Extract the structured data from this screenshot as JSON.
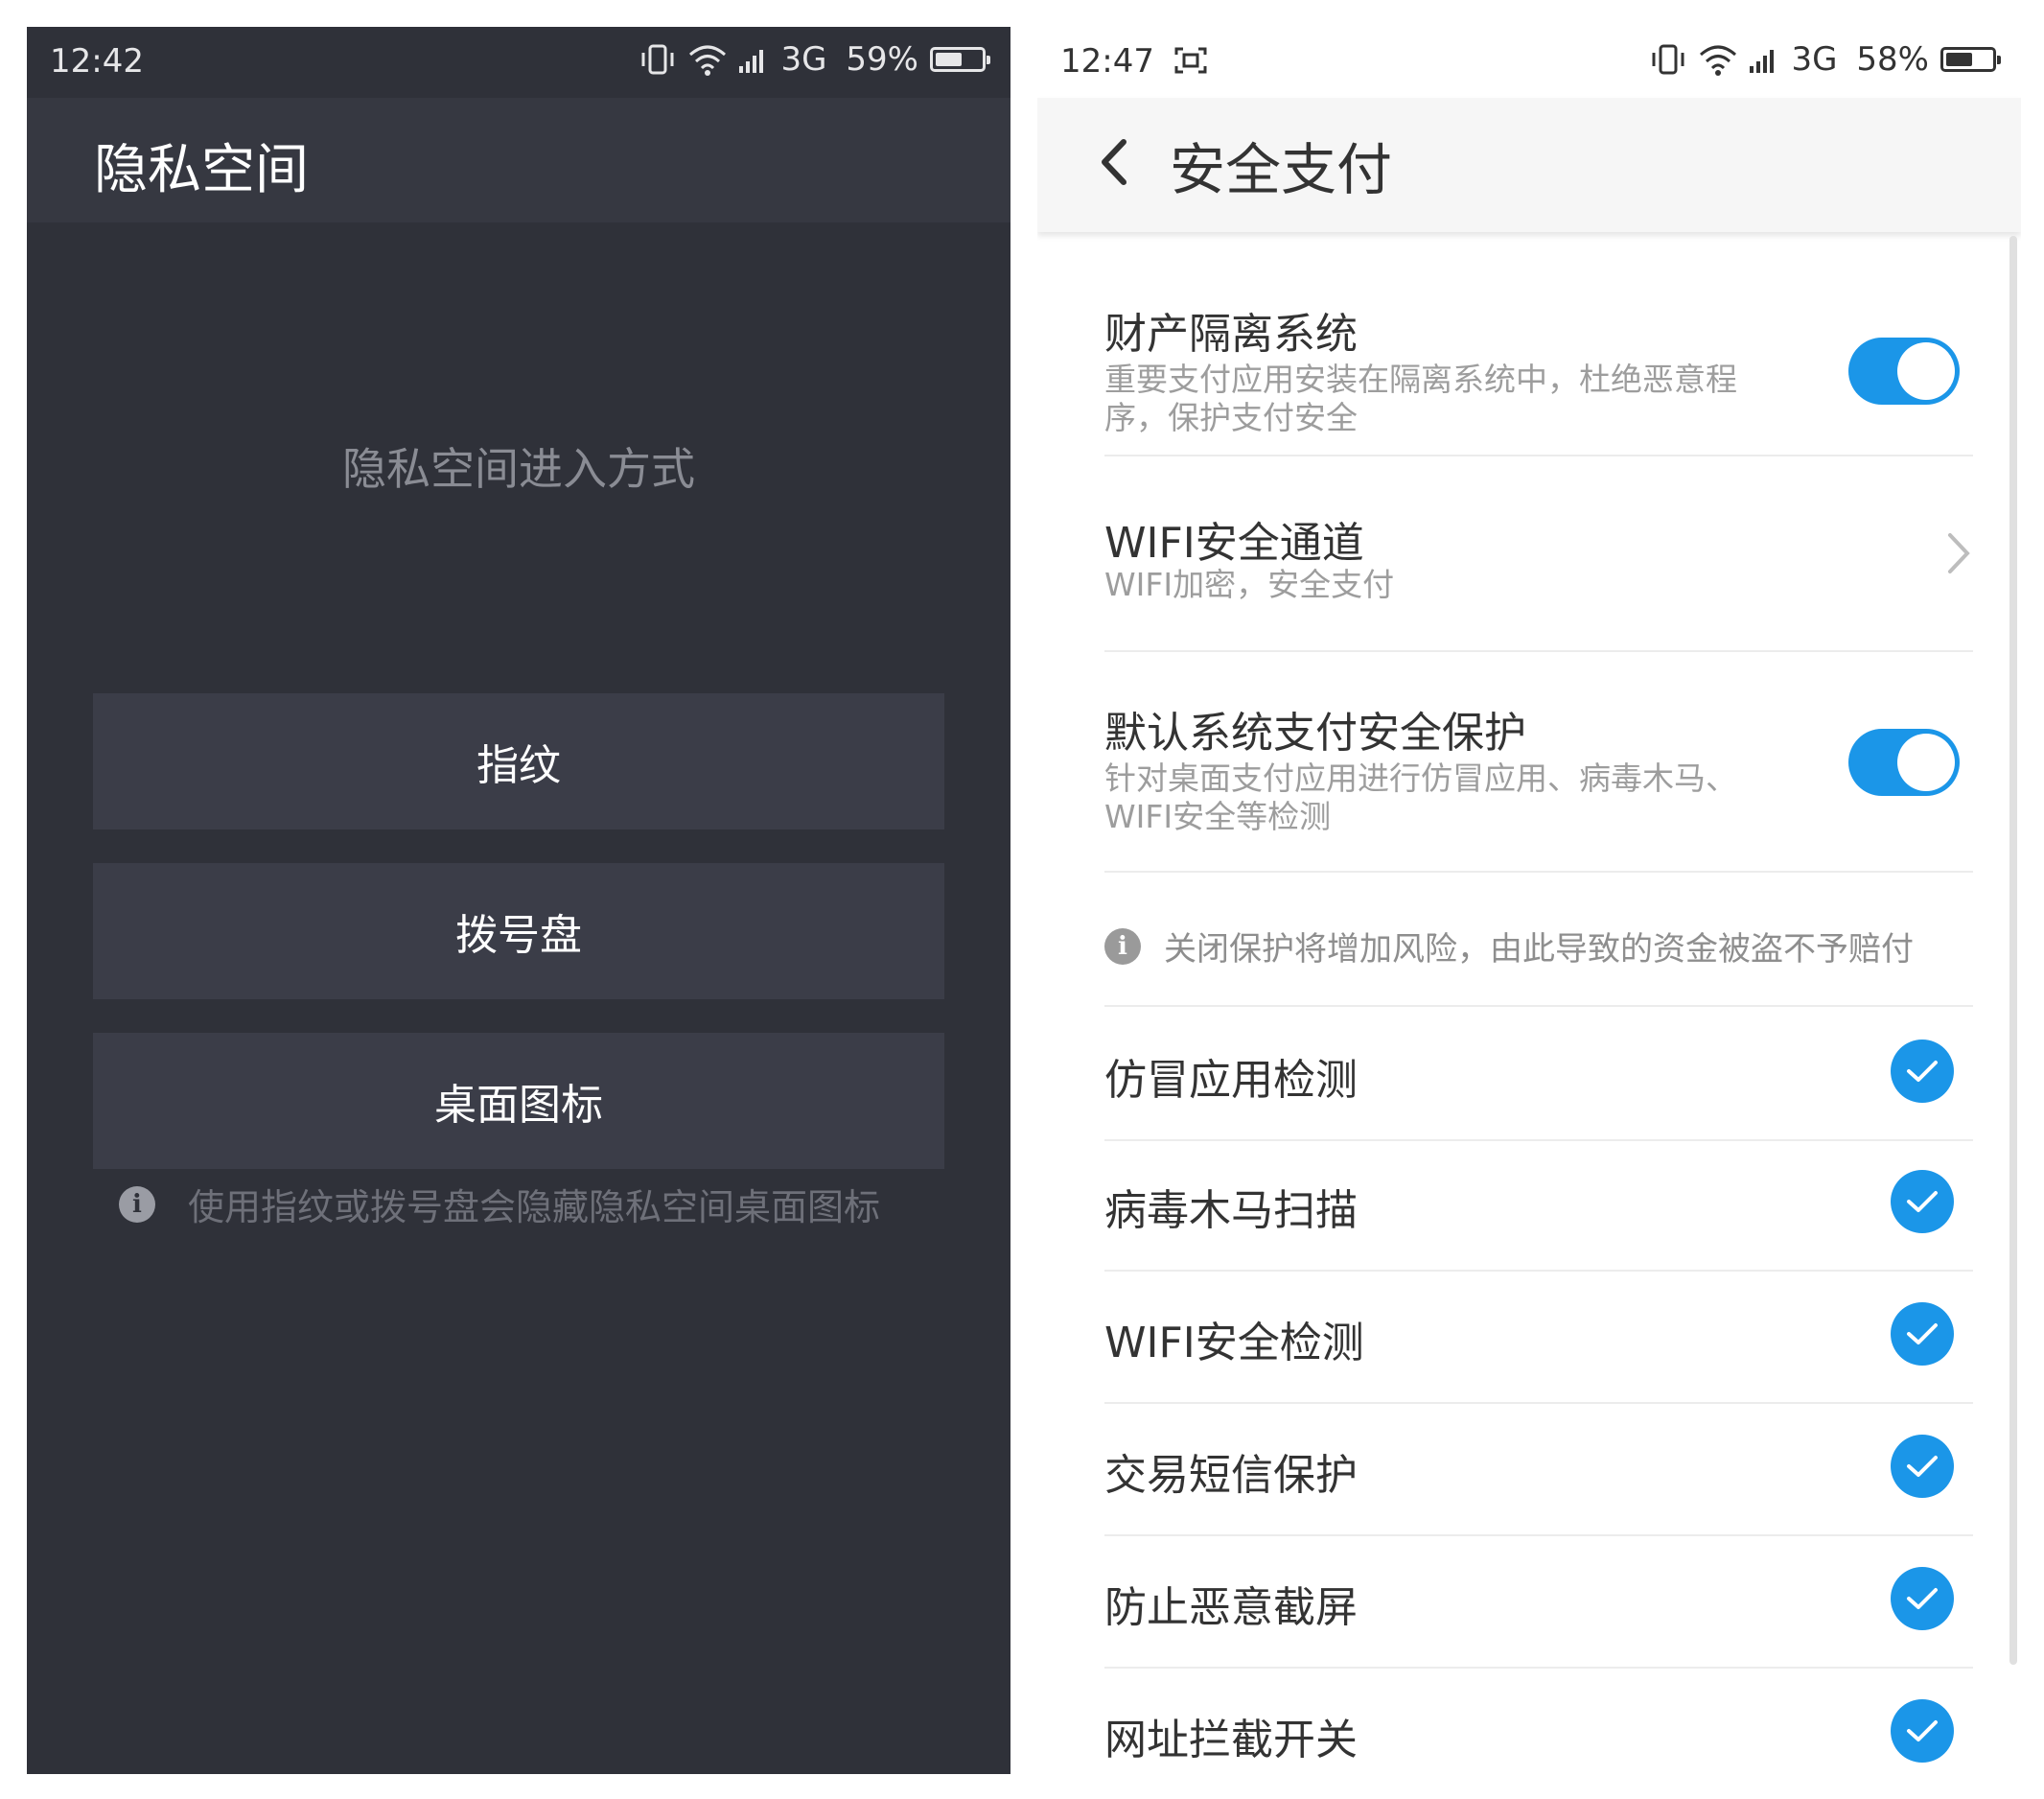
{
  "left": {
    "status": {
      "time": "12:42",
      "network": "3G",
      "battery": "59%",
      "battery_level": 0.59
    },
    "title": "隐私空间",
    "subtitle": "隐私空间进入方式",
    "options": [
      "指纹",
      "拨号盘",
      "桌面图标"
    ],
    "note": "使用指纹或拨号盘会隐藏隐私空间桌面图标"
  },
  "right": {
    "status": {
      "time": "12:47",
      "network": "3G",
      "battery": "58%",
      "battery_level": 0.58
    },
    "title": "安全支付",
    "items": [
      {
        "title": "财产隔离系统",
        "desc": "重要支付应用安装在隔离系统中，杜绝恶意程序，保护支付安全",
        "control": "toggle",
        "on": true
      },
      {
        "title": "WIFI安全通道",
        "desc": "WIFI加密，安全支付",
        "control": "chevron"
      },
      {
        "title": "默认系统支付安全保护",
        "desc": "针对桌面支付应用进行仿冒应用、病毒木马、WIFI安全等检测",
        "control": "toggle",
        "on": true
      }
    ],
    "warning": "关闭保护将增加风险，由此导致的资金被盗不予赔付",
    "checks": [
      "仿冒应用检测",
      "病毒木马扫描",
      "WIFI安全检测",
      "交易短信保护",
      "防止恶意截屏",
      "网址拦截开关"
    ]
  },
  "colors": {
    "accent": "#1b96e8",
    "dark_bg": "#2f3139",
    "button_bg": "#3b3d48"
  }
}
